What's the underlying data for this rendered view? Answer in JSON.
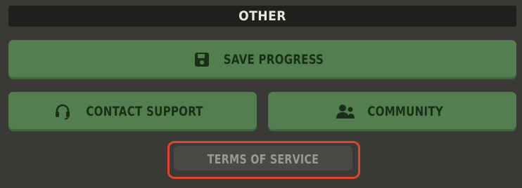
{
  "section": {
    "title": "OTHER"
  },
  "buttons": {
    "save_progress": {
      "label": "SAVE PROGRESS",
      "icon": "save-icon"
    },
    "contact_support": {
      "label": "CONTACT SUPPORT",
      "icon": "headset-icon"
    },
    "community": {
      "label": "COMMUNITY",
      "icon": "users-icon"
    },
    "terms_of_service": {
      "label": "TERMS OF SERVICE"
    }
  },
  "colors": {
    "background": "#3a3936",
    "header": "#1f1f1d",
    "button_green": "#537e4f",
    "button_text": "#1a2f17",
    "tos_button": "#4a4945",
    "highlight": "#e0432c"
  }
}
